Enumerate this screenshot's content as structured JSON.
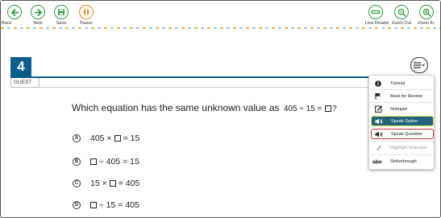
{
  "toolbar": {
    "back": "Back",
    "next": "Next",
    "save": "Save",
    "pause": "Pause",
    "line_reader": "Line Reader",
    "zoom_out": "Zoom Out",
    "zoom_in": "Zoom In"
  },
  "question": {
    "number": "4",
    "user": "GUEST",
    "stem": "Which equation has the same unknown value as",
    "stem_eq_left": "405 ÷ 15 =",
    "stem_eq_right": "?",
    "options": [
      {
        "letter": "A",
        "pre": "405 ×",
        "post": "= 15"
      },
      {
        "letter": "B",
        "pre": "",
        "post": "÷ 405 = 15"
      },
      {
        "letter": "C",
        "pre": "15 ×",
        "post": "= 405"
      },
      {
        "letter": "D",
        "pre": "",
        "post": "÷ 15 = 405"
      }
    ]
  },
  "context_menu": {
    "items": [
      {
        "label": "Tutorial",
        "icon": "info-icon"
      },
      {
        "label": "Mark for Review",
        "icon": "flag-icon"
      },
      {
        "label": "Notepad",
        "icon": "notepad-icon"
      },
      {
        "label": "Speak Option",
        "icon": "speaker-icon",
        "state": "active"
      },
      {
        "label": "Speak Question",
        "icon": "speaker-icon",
        "state": "outlined"
      },
      {
        "label": "Highlight Selection",
        "icon": "highlighter-icon",
        "state": "disabled"
      },
      {
        "label": "Strikethrough",
        "icon": "strikethrough-icon"
      }
    ]
  },
  "colors": {
    "question_blue": "#0b5e8c",
    "nav_green": "#2e9e3e",
    "pause_orange": "#f28a1e",
    "active_item": "#22637d",
    "active_outline": "#d8e84a",
    "outlined_item": "#c8323c"
  }
}
